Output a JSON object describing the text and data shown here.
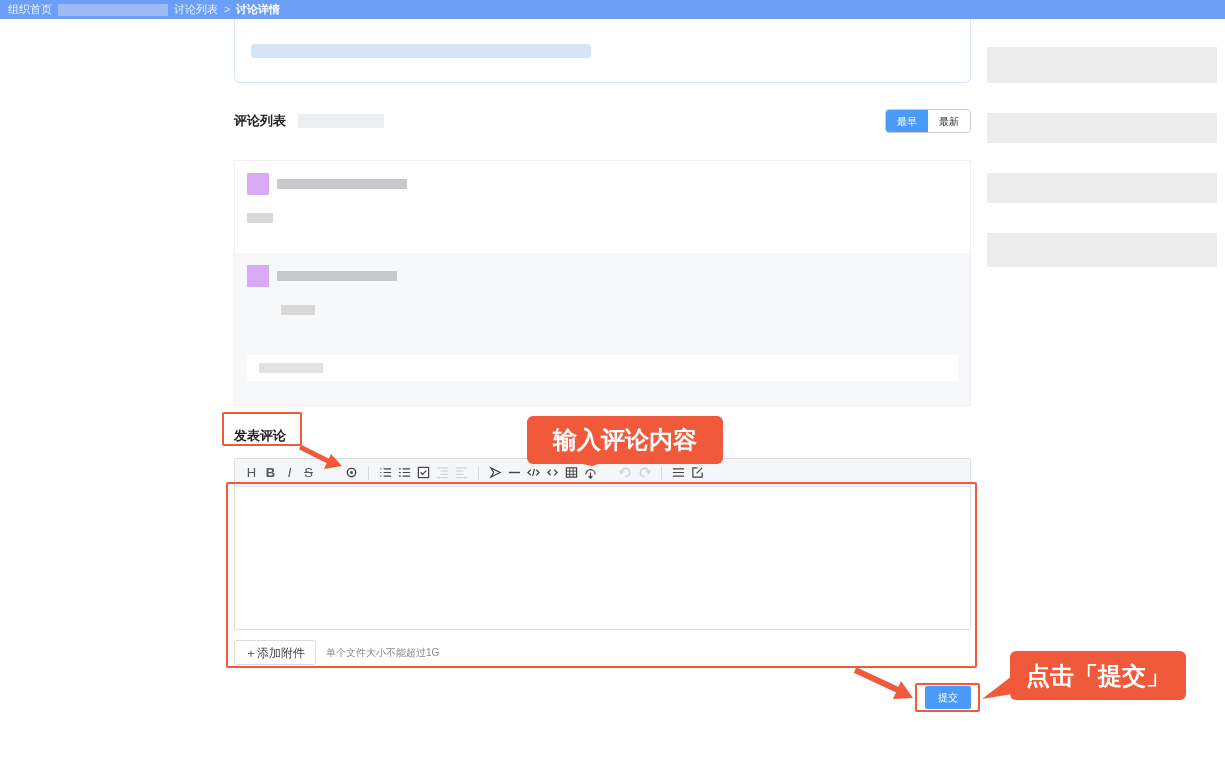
{
  "breadcrumb": [
    {
      "label": "组织首页",
      "current": false
    },
    {
      "label": "讨论列表",
      "current": false
    },
    {
      "label": "讨论详情",
      "current": true
    }
  ],
  "breadcrumb_separator": ">",
  "comments_section": {
    "title": "评论列表",
    "sort_options": [
      {
        "label": "最早",
        "selected": true
      },
      {
        "label": "最新",
        "selected": false
      }
    ]
  },
  "compose": {
    "title": "发表评论",
    "toolbar_letters": [
      "H",
      "B",
      "I",
      "S"
    ],
    "toolbar_icons": [
      {
        "disabled": false
      },
      {
        "disabled": false
      },
      {
        "disabled": false
      },
      {
        "disabled": false
      },
      {
        "disabled": true
      },
      {
        "disabled": true
      },
      {
        "disabled": false
      },
      {
        "disabled": false
      },
      {
        "disabled": false
      },
      {
        "disabled": false
      },
      {
        "disabled": false
      },
      {
        "disabled": false
      },
      {
        "disabled": true
      },
      {
        "disabled": true
      },
      {
        "disabled": false
      },
      {
        "disabled": false
      }
    ],
    "attach_button": "＋添加附件",
    "attach_hint": "单个文件大小不能超过1G",
    "submit_button": "提交"
  },
  "annotations": [
    {
      "kind": "callout",
      "text": "输入评论内容"
    },
    {
      "kind": "callout",
      "text": "点击「提交」"
    }
  ]
}
